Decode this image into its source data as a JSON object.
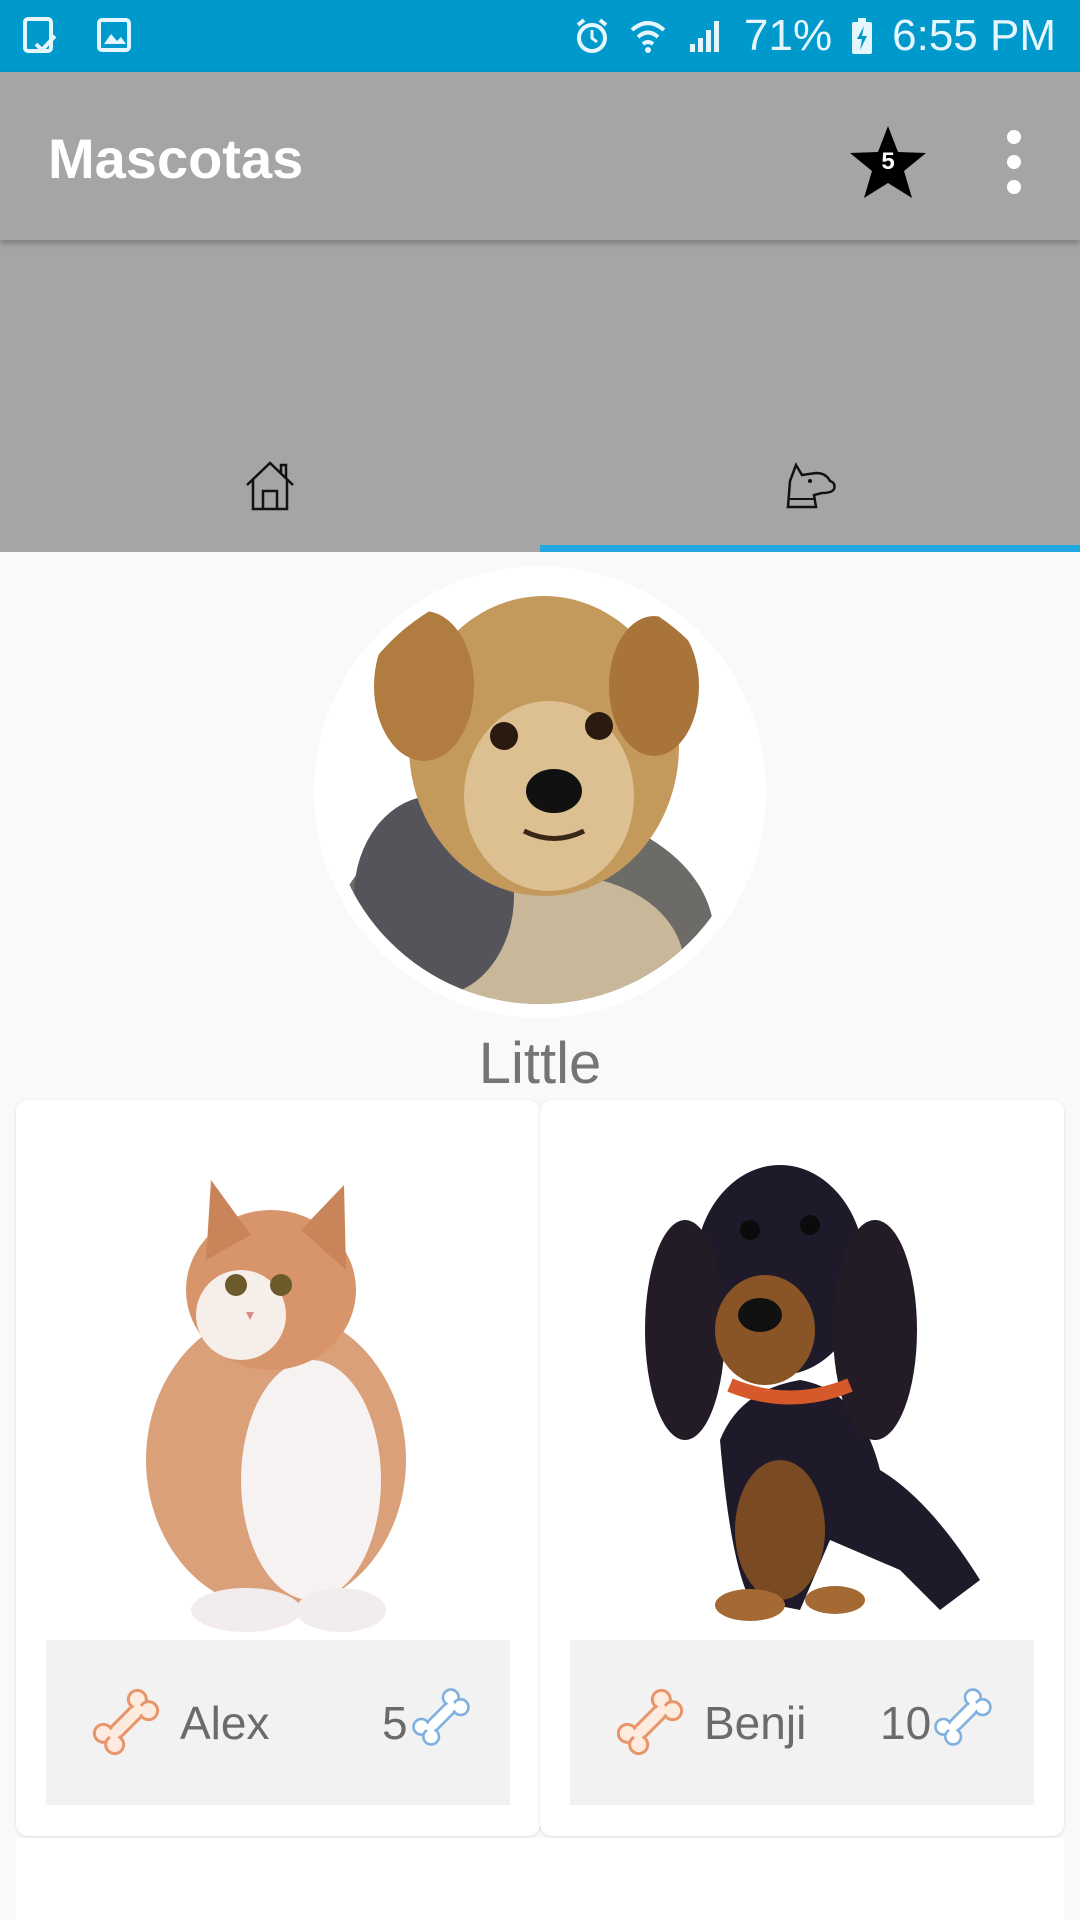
{
  "status_bar": {
    "battery": "71%",
    "time": "6:55 PM"
  },
  "app_bar": {
    "title": "Mascotas",
    "favorites_count": "5"
  },
  "tabs": [
    {
      "icon": "home-icon",
      "selected": false
    },
    {
      "icon": "dog-head-icon",
      "selected": true
    }
  ],
  "profile": {
    "name": "Little"
  },
  "pets": [
    {
      "name": "Alex",
      "rating": "5"
    },
    {
      "name": "Benji",
      "rating": "10"
    }
  ],
  "colors": {
    "status_bar": "#0099cc",
    "app_bar": "#a5a5a5",
    "tab_indicator": "#22a7e0",
    "bone_like": "#e8956a",
    "bone_rating": "#7fb0e0"
  }
}
